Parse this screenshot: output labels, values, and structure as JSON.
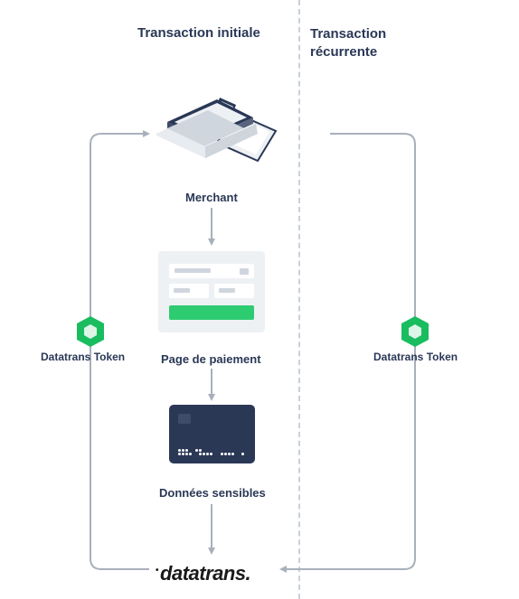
{
  "titles": {
    "left": "Transaction initiale",
    "right": "Transaction récurrente"
  },
  "stages": {
    "merchant": "Merchant",
    "payment": "Page de paiement",
    "sensitive": "Données sensibles"
  },
  "tokens": {
    "left": "Datatrans Token",
    "right": "Datatrans Token"
  },
  "brand": "datatrans.",
  "colors": {
    "primary_dark": "#2a3856",
    "accent_green": "#1abc60",
    "button_green": "#2ecc71",
    "arrow_gray": "#a8b0bc"
  },
  "diagram": {
    "type": "flow",
    "description": "Tokenization flow showing initial transaction (merchant → payment page → sensitive data → datatrans) on left producing a Datatrans Token returned to merchant, and recurring transaction on right where token goes directly between merchant context and datatrans.",
    "left_flow": [
      "Merchant",
      "Page de paiement",
      "Données sensibles",
      "datatrans"
    ],
    "left_return": "Datatrans Token",
    "right_flow": [
      "datatrans",
      "Datatrans Token",
      "(recurring)"
    ]
  }
}
